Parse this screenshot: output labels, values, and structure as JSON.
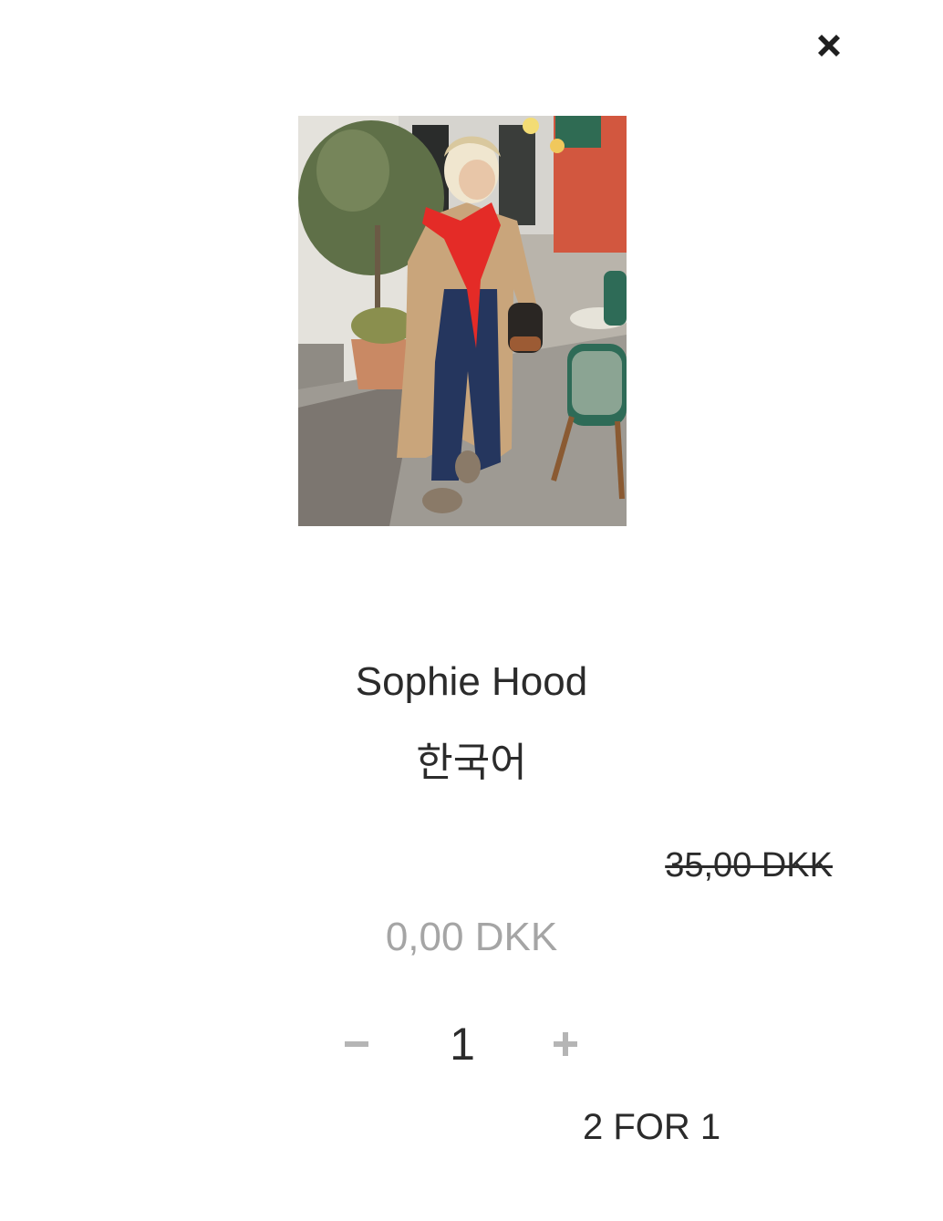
{
  "modal": {
    "close_icon": "close-icon"
  },
  "product": {
    "image_icon": "product-photo",
    "title": "Sophie Hood",
    "language": "한국어",
    "original_price": "35,00 DKK",
    "price": "0,00 DKK",
    "promo": "2 FOR 1"
  },
  "quantity": {
    "decrement_icon": "minus-icon",
    "value": "1",
    "increment_icon": "plus-icon"
  },
  "colors": {
    "text": "#2b2b2b",
    "price_muted": "#a5a5a5",
    "control_muted": "#b5b5b5",
    "close": "#1f1f1f"
  }
}
